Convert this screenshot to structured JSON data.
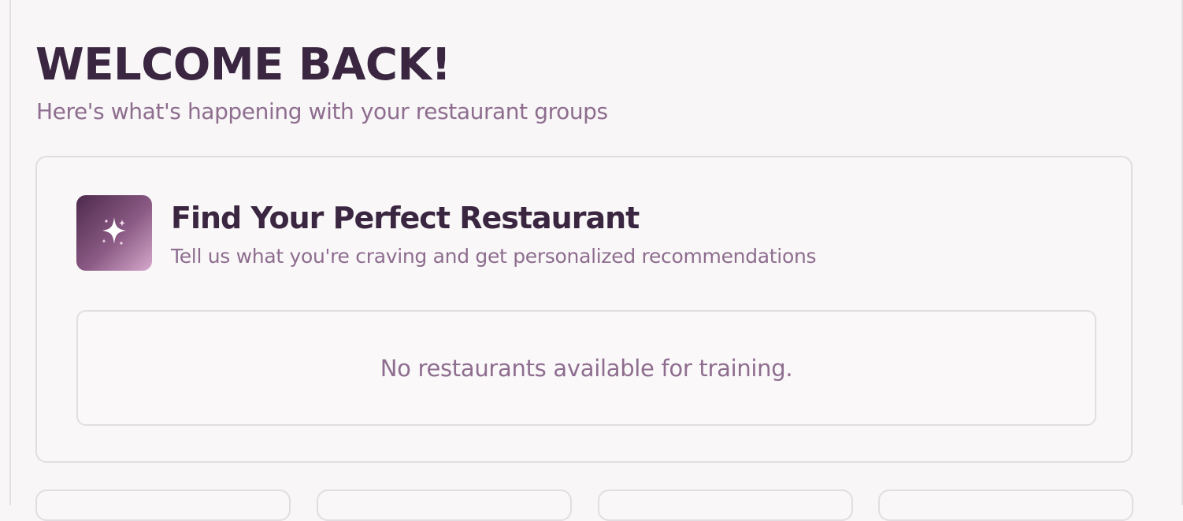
{
  "header": {
    "title": "WELCOME BACK!",
    "subtitle": "Here's what's happening with your restaurant groups"
  },
  "finder_card": {
    "icon": "sparkles-icon",
    "title": "Find Your Perfect Restaurant",
    "subtitle": "Tell us what you're craving and get personalized recommendations",
    "empty_message": "No restaurants available for training."
  },
  "colors": {
    "background": "#f8f6f7",
    "title": "#3a2640",
    "muted_text": "#8e6d8f",
    "border": "#e2dde1",
    "icon_gradient_start": "#4e2a4d",
    "icon_gradient_end": "#d6a8cc"
  }
}
